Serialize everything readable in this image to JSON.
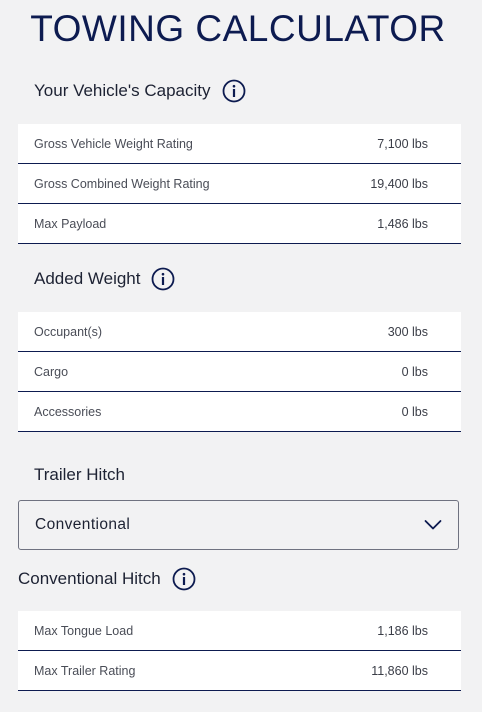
{
  "title": "TOWING CALCULATOR",
  "vehicle_capacity": {
    "heading": "Your Vehicle's Capacity",
    "rows": [
      {
        "label": "Gross Vehicle Weight Rating",
        "value": "7,100 lbs"
      },
      {
        "label": "Gross Combined Weight Rating",
        "value": "19,400 lbs"
      },
      {
        "label": "Max Payload",
        "value": "1,486 lbs"
      }
    ]
  },
  "added_weight": {
    "heading": "Added Weight",
    "rows": [
      {
        "label": "Occupant(s)",
        "value": "300 lbs"
      },
      {
        "label": "Cargo",
        "value": "0 lbs"
      },
      {
        "label": "Accessories",
        "value": "0 lbs"
      }
    ]
  },
  "trailer_hitch": {
    "heading": "Trailer Hitch",
    "selected": "Conventional"
  },
  "conventional_hitch": {
    "heading": "Conventional Hitch",
    "rows": [
      {
        "label": "Max Tongue Load",
        "value": "1,186 lbs"
      },
      {
        "label": "Max Trailer Rating",
        "value": "11,860 lbs"
      }
    ]
  },
  "icons": {
    "info": "info-circle-icon",
    "dropdown": "chevron-down-icon"
  },
  "colors": {
    "accent": "#0d1b50",
    "background": "#f2f2f3",
    "card": "#ffffff"
  }
}
